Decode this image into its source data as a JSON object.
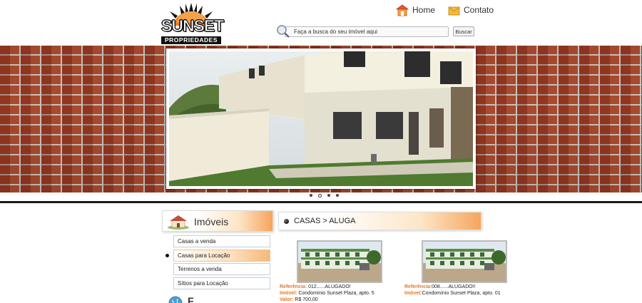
{
  "header": {
    "logo_title": "SUNSET",
    "logo_sub": "PROPRIEDADES",
    "nav": [
      {
        "label": "Home",
        "icon": "home-icon"
      },
      {
        "label": "Contato",
        "icon": "mail-icon"
      }
    ],
    "search": {
      "placeholder": "Faça a busca do seu imóvel aqui",
      "button": "Buscar"
    }
  },
  "banner": {
    "slides": 4,
    "active_slide": 1
  },
  "sidebar": {
    "title": "Imóveis",
    "items": [
      {
        "label": "Casas a venda"
      },
      {
        "label": "Casas para Locação"
      },
      {
        "label": "Terrenos a venda"
      },
      {
        "label": "Sítios para Locação"
      }
    ],
    "active_index": 1,
    "second_title": "F"
  },
  "content": {
    "title": "CASAS > ALUGA",
    "listings": [
      {
        "ref_label": "Referência:",
        "ref_value": " 012......ALUGADO!",
        "imovel_label": "Imóvel:",
        "imovel_value": " Condomínio Sunset Plaza, apto. 5",
        "valor_label": "Valor:",
        "valor_value": " R$ 700,00"
      },
      {
        "ref_label": "Referência:",
        "ref_value": "008......ALUGADO!!",
        "imovel_label": "Imóvel:",
        "imovel_value": "Condomínio Sunset Plaza, apto. 01",
        "valor_label": "",
        "valor_value": ""
      }
    ]
  },
  "colors": {
    "accent": "#f5a65e",
    "label_orange": "#e07a2a",
    "brick": "#a84a2e"
  }
}
